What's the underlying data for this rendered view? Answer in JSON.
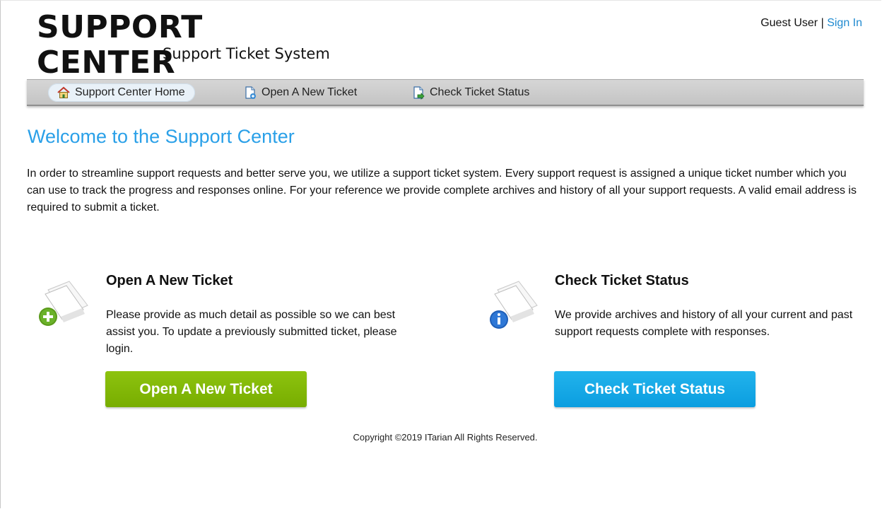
{
  "header": {
    "title": "SUPPORT CENTER",
    "subtitle": "Support Ticket System",
    "user": "Guest User",
    "separator": "|",
    "sign_in": "Sign In"
  },
  "nav": {
    "items": [
      {
        "label": "Support Center Home",
        "icon": "home-icon"
      },
      {
        "label": "Open A New Ticket",
        "icon": "new-ticket-icon"
      },
      {
        "label": "Check Ticket Status",
        "icon": "ticket-status-icon"
      }
    ]
  },
  "main": {
    "heading": "Welcome to the Support Center",
    "intro": "In order to streamline support requests and better serve you, we utilize a support ticket system. Every support request is assigned a unique ticket number which you can use to track the progress and responses online. For your reference we provide complete archives and history of all your support requests. A valid email address is required to submit a ticket."
  },
  "open_ticket": {
    "title": "Open A New Ticket",
    "description": "Please provide as much detail as possible so we can best assist you. To update a previously submitted ticket, please login.",
    "button": "Open A New Ticket",
    "icon": "new-ticket-document-icon"
  },
  "check_status": {
    "title": "Check Ticket Status",
    "description": "We provide archives and history of all your current and past support requests complete with responses.",
    "button": "Check Ticket Status",
    "icon": "ticket-status-document-icon"
  },
  "footer": {
    "copyright": "Copyright ©2019 ITarian All Rights Reserved."
  },
  "colors": {
    "heading": "#2aa0e8",
    "link": "#1f8ad0",
    "green_button": "#80b500",
    "blue_button": "#12a6e6"
  }
}
